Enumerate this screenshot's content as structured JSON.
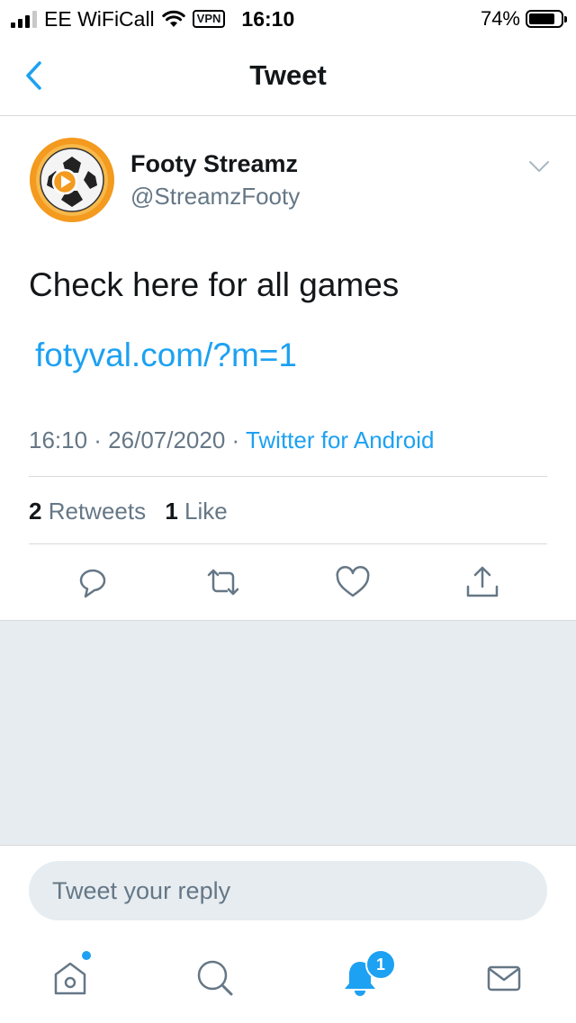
{
  "status_bar": {
    "carrier": "EE WiFiCall",
    "vpn": "VPN",
    "time": "16:10",
    "battery_percent": "74%",
    "signal_bars_filled": 3,
    "signal_bars_total": 4
  },
  "header": {
    "title": "Tweet",
    "back_icon": "chevron-left-icon"
  },
  "tweet": {
    "author_name": "Footy Streamz",
    "author_handle": "@StreamzFooty",
    "avatar_icon": "soccer-ball-play-logo",
    "text": "Check here for all games",
    "link": "fotyval.com/?m=1",
    "timestamp": "16:10 · 26/07/2020 · ",
    "source": "Twitter for Android",
    "retweet_count": "2",
    "retweet_label": "Retweets",
    "like_count": "1",
    "like_label": "Like",
    "actions": [
      "reply-icon",
      "retweet-icon",
      "like-icon",
      "share-icon"
    ]
  },
  "reply": {
    "placeholder": "Tweet your reply"
  },
  "tab_bar": {
    "items": [
      "home-icon",
      "search-icon",
      "notifications-icon",
      "messages-icon"
    ],
    "notifications_badge": "1"
  },
  "colors": {
    "accent": "#1da1f2",
    "text_primary": "#14171a",
    "text_secondary": "#657786",
    "background_gray": "#e6ecf0"
  }
}
